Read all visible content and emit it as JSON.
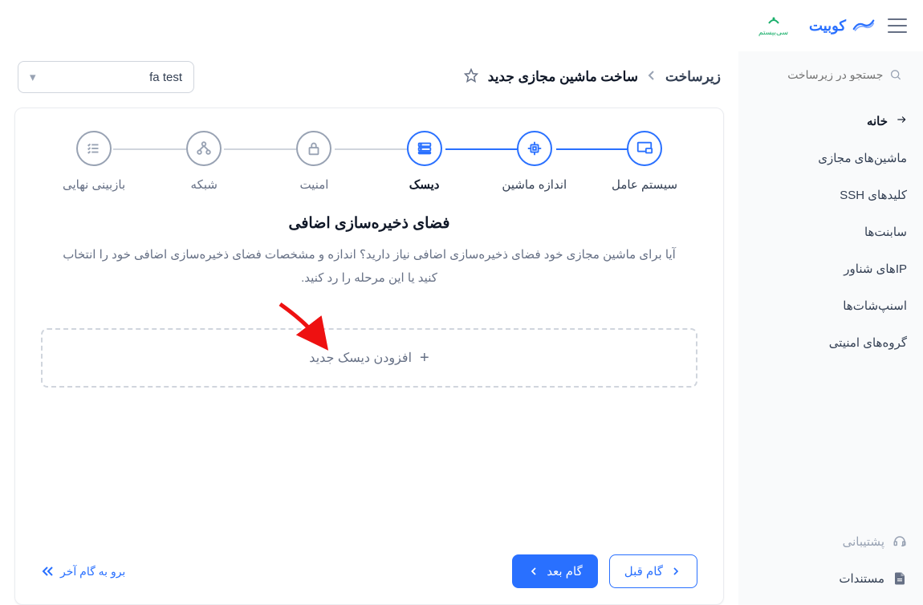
{
  "brand": {
    "name": "کوبیت"
  },
  "search": {
    "placeholder": "جستجو در زیرساخت"
  },
  "sidebar": {
    "items": [
      {
        "label": "خانه",
        "active": true
      },
      {
        "label": "ماشین‌های مجازی"
      },
      {
        "label": "کلیدهای SSH"
      },
      {
        "label": "سابنت‌ها"
      },
      {
        "label": "IPهای شناور"
      },
      {
        "label": "اسنپ‌شات‌ها"
      },
      {
        "label": "گروه‌های امنیتی"
      }
    ],
    "bottom": {
      "support": "پشتیبانی",
      "docs": "مستندات"
    }
  },
  "breadcrumb": {
    "root": "زیرساخت",
    "current": "ساخت ماشین مجازی جدید"
  },
  "projectSelect": {
    "value": "fa test"
  },
  "stepper": {
    "steps": [
      {
        "label": "سیستم عامل",
        "state": "done"
      },
      {
        "label": "اندازه ماشین",
        "state": "done"
      },
      {
        "label": "دیسک",
        "state": "active"
      },
      {
        "label": "امنیت",
        "state": "todo"
      },
      {
        "label": "شبکه",
        "state": "todo"
      },
      {
        "label": "بازبینی نهایی",
        "state": "todo"
      }
    ]
  },
  "section": {
    "title": "فضای ذخیره‌سازی اضافی",
    "desc": "آیا برای ماشین مجازی خود فضای ذخیره‌سازی اضافی نیاز دارید؟ اندازه و مشخصات فضای ذخیره‌سازی اضافی خود را انتخاب کنید یا این مرحله را رد کنید.",
    "addDisk": "افزودن دیسک جدید"
  },
  "footer": {
    "prev": "گام قبل",
    "next": "گام بعد",
    "skip": "برو به گام آخر"
  }
}
